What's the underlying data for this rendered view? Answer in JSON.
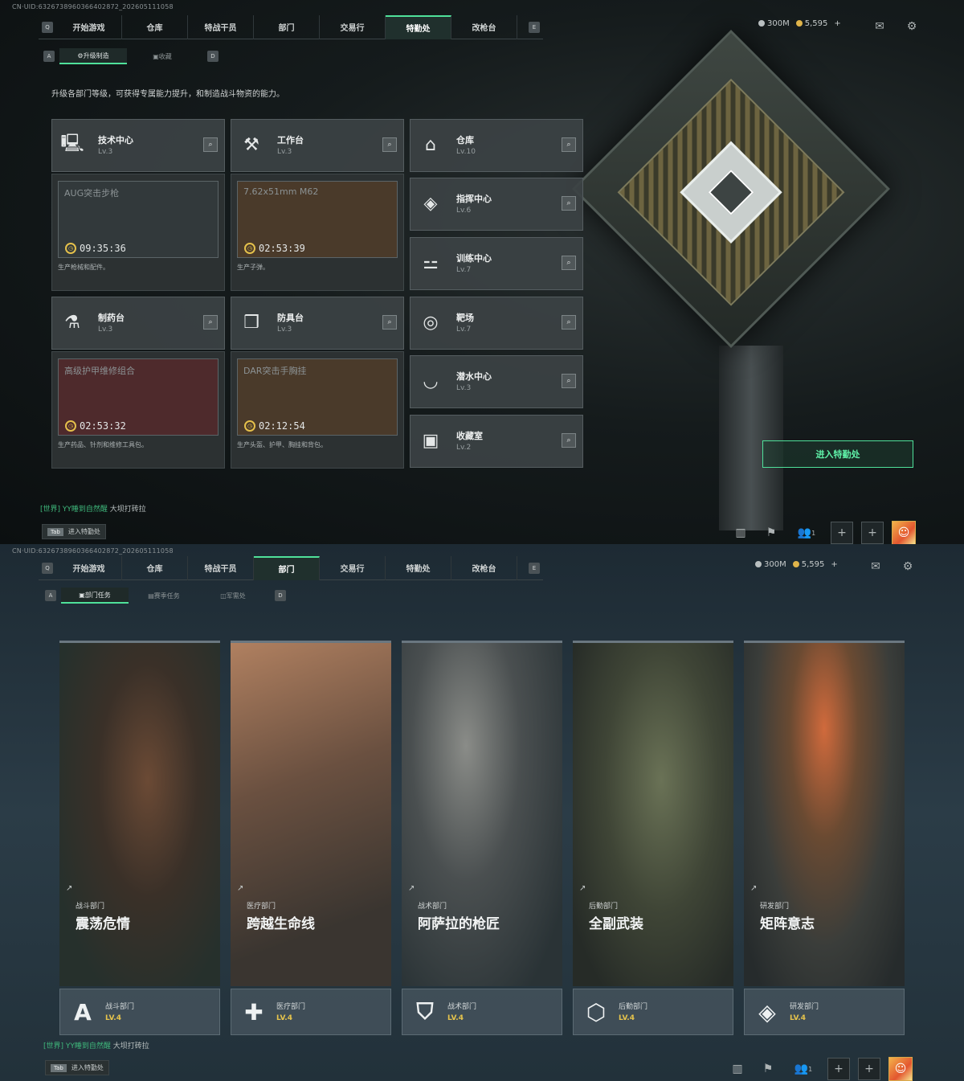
{
  "top": {
    "uid": "CN·UID:6326738960366402872_202605111058",
    "nav": {
      "key_left": "Q",
      "key_right": "E",
      "tabs": [
        "开始游戏",
        "仓库",
        "特战干员",
        "部门",
        "交易行",
        "特勤处",
        "改枪台"
      ],
      "active": "特勤处"
    },
    "resources": {
      "silver": "300M",
      "gold": "5,595",
      "plus": "+"
    },
    "subtabs": {
      "key_left": "A",
      "key_right": "D",
      "items": [
        "升级制造",
        "收藏"
      ]
    },
    "description": "升级各部门等级，可获得专属能力提升，和制造战斗物资的能力。",
    "facilities_left": [
      {
        "name": "技术中心",
        "level": "Lv.3",
        "icon": "computer-icon",
        "product": "AUG突击步枪",
        "timer": "09:35:36",
        "desc": "生产枪械和配件。",
        "tint": "#32393b"
      },
      {
        "name": "工作台",
        "level": "Lv.3",
        "icon": "tools-icon",
        "product": "7.62x51mm M62",
        "timer": "02:53:39",
        "desc": "生产子弹。",
        "tint": "#4a3a2a"
      },
      {
        "name": "制药台",
        "level": "Lv.3",
        "icon": "microscope-icon",
        "product": "高级护甲维修组合",
        "timer": "02:53:32",
        "desc": "生产药品、针剂和维修工具包。",
        "tint": "#4e2a2c"
      },
      {
        "name": "防具台",
        "level": "Lv.3",
        "icon": "cubes-icon",
        "product": "DAR突击手胸挂",
        "timer": "02:12:54",
        "desc": "生产头盔、护甲、胸挂和背包。",
        "tint": "#4a3a2a"
      }
    ],
    "facilities_right": [
      {
        "name": "仓库",
        "level": "Lv.10",
        "icon": "warehouse-icon",
        "glyph": "⌂"
      },
      {
        "name": "指挥中心",
        "level": "Lv.6",
        "icon": "chip-icon",
        "glyph": "◈"
      },
      {
        "name": "训练中心",
        "level": "Lv.7",
        "icon": "dumbbell-icon",
        "glyph": "⚍"
      },
      {
        "name": "靶场",
        "level": "Lv.7",
        "icon": "target-icon",
        "glyph": "◎"
      },
      {
        "name": "潜水中心",
        "level": "Lv.3",
        "icon": "diving-mask-icon",
        "glyph": "◡"
      },
      {
        "name": "收藏室",
        "level": "Lv.2",
        "icon": "collection-icon",
        "glyph": "▣"
      }
    ],
    "enter_button": "进入特勤处",
    "chat": {
      "channel": "[世界]",
      "name": "YY睡到自然醒",
      "text": "大坝打砖拉"
    },
    "tab_hint": {
      "key": "Tab",
      "label": "进入特勤处"
    },
    "players": "1"
  },
  "bottom": {
    "uid": "CN·UID:6326738960366402872_202605111058",
    "nav": {
      "key_left": "Q",
      "key_right": "E",
      "tabs": [
        "开始游戏",
        "仓库",
        "特战干员",
        "部门",
        "交易行",
        "特勤处",
        "改枪台"
      ],
      "active": "部门"
    },
    "resources": {
      "silver": "300M",
      "gold": "5,595",
      "plus": "+"
    },
    "subtabs": {
      "key_left": "A",
      "key_right": "D",
      "items": [
        "部门任务",
        "赛季任务",
        "军需处"
      ]
    },
    "departments": [
      {
        "dept": "战斗部门",
        "title": "震荡危情",
        "level": "LV.4",
        "icon": "combat-dept-icon",
        "glyph": "A"
      },
      {
        "dept": "医疗部门",
        "title": "跨越生命线",
        "level": "LV.4",
        "icon": "medical-dept-icon",
        "glyph": "✚"
      },
      {
        "dept": "战术部门",
        "title": "阿萨拉的枪匠",
        "level": "LV.4",
        "icon": "tactical-dept-icon",
        "glyph": "⛉",
        "footer_name": "战术部门"
      },
      {
        "dept": "后勤部门",
        "title": "全副武装",
        "level": "LV.4",
        "icon": "logistics-dept-icon",
        "glyph": "⬡"
      },
      {
        "dept": "研发部门",
        "title": "矩阵意志",
        "level": "LV.4",
        "icon": "research-dept-icon",
        "glyph": "◈"
      }
    ],
    "chat": {
      "channel": "[世界]",
      "name": "YY睡到自然醒",
      "text": "大坝打砖拉"
    },
    "tab_hint": {
      "key": "Tab",
      "label": "进入特勤处"
    },
    "players": "1"
  }
}
